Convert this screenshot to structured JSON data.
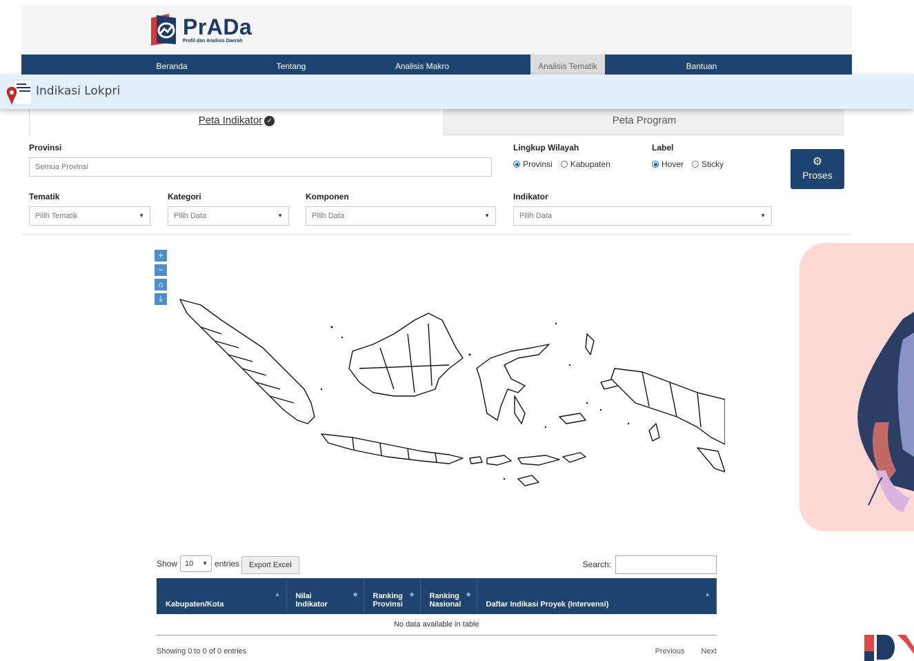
{
  "brand": {
    "title": "PrADa",
    "subtitle": "Profil dan Analisis Daerah"
  },
  "nav": {
    "items": [
      {
        "label": "Beranda"
      },
      {
        "label": "Tentang"
      },
      {
        "label": "Analisis Makro"
      },
      {
        "label": "Analisis Tematik",
        "active": true
      },
      {
        "label": "Bantuan"
      }
    ]
  },
  "banner": {
    "title": "Indikasi Lokpri"
  },
  "tabs": {
    "left": "Peta Indikator",
    "right": "Peta Program"
  },
  "filters": {
    "provinsi": {
      "label": "Provinsi",
      "placeholder": "Semua Provinsi"
    },
    "lingkup": {
      "label": "Lingkup Wilayah",
      "options": [
        "Provinsi",
        "Kabupaten"
      ],
      "selected": "Provinsi"
    },
    "label_opt": {
      "label": "Label",
      "options": [
        "Hover",
        "Sticky"
      ],
      "selected": "Hover"
    },
    "tematik": {
      "label": "Tematik",
      "value": "Pilih Tematik"
    },
    "kategori": {
      "label": "Kategori",
      "value": "Pilih Data"
    },
    "komponen": {
      "label": "Komponen",
      "value": "Pilih Data"
    },
    "indikator": {
      "label": "Indikator",
      "value": "Pilih Data"
    },
    "proses": "Proses"
  },
  "map": {
    "tools": [
      "zoom-in",
      "zoom-out",
      "home",
      "download"
    ]
  },
  "table": {
    "show": "Show",
    "length": "10",
    "entries": "entries",
    "export": "Export Excel",
    "search": "Search:",
    "columns": {
      "c1": "Kabupaten/Kota",
      "c2a": "Nilai",
      "c2b": "Indikator",
      "c3a": "Ranking",
      "c3b": "Provinsi",
      "c4a": "Ranking",
      "c4b": "Nasional",
      "c5": "Daftar Indikasi Proyek (Intervensi)"
    },
    "empty": "No data available in table",
    "info": "Showing 0 to 0 of 0 entries",
    "previous": "Previous",
    "next": "Next"
  },
  "colors": {
    "nav": "#1d4471",
    "banner": "#e4effc",
    "accent": "#0b63d6",
    "deco": "#fcd9d5"
  }
}
